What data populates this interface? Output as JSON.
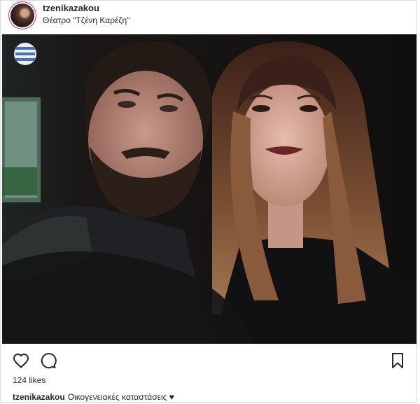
{
  "post": {
    "username": "tzenikazakou",
    "location": "Θέατρο \"Τζένη Καρέζη\"",
    "photo_description": "",
    "likes": "124 likes",
    "caption_user": "tzenikazakou",
    "caption_text": "Οικογενειακές καταστάσεις ♥"
  },
  "icons": {
    "like": "heart-icon",
    "comment": "comment-icon",
    "save": "bookmark-icon"
  },
  "colors": {
    "text": "#262626",
    "border": "#dbdbdb",
    "avatar_ring": "#c13584"
  }
}
